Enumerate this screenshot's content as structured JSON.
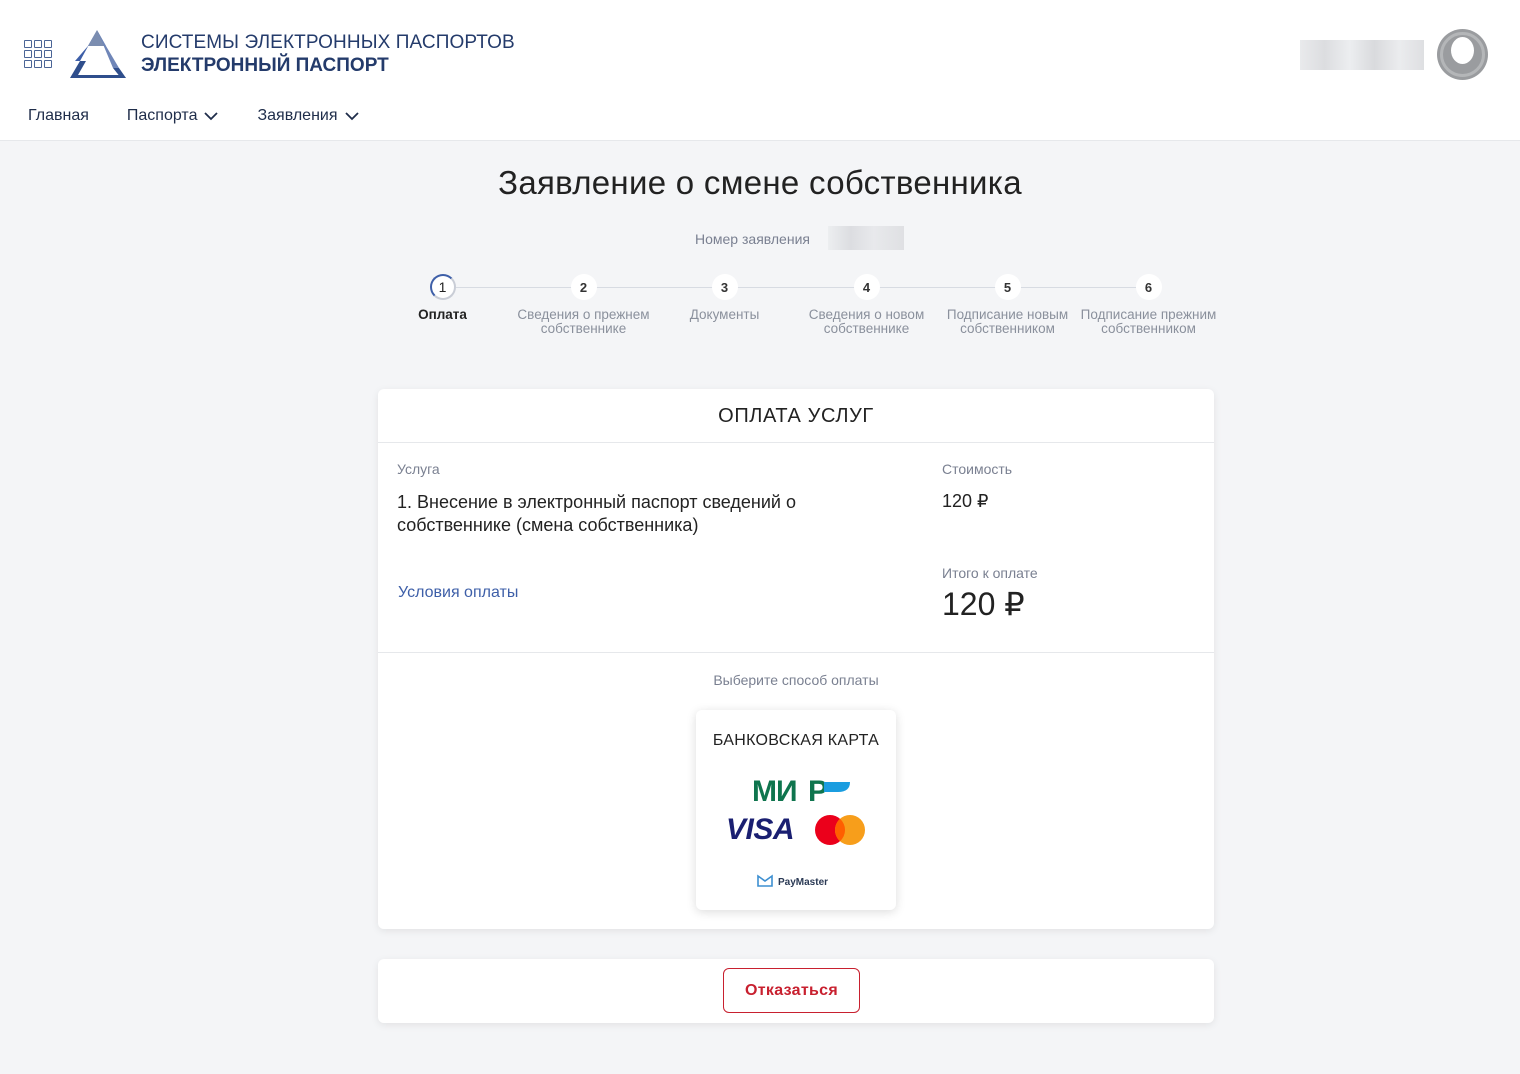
{
  "brand": {
    "line1": "СИСТЕМЫ ЭЛЕКТРОННЫХ ПАСПОРТОВ",
    "line2": "ЭЛЕКТРОННЫЙ ПАСПОРТ"
  },
  "nav": {
    "home": "Главная",
    "passports": "Паспорта",
    "applications": "Заявления"
  },
  "page": {
    "title": "Заявление о смене собственника",
    "number_label": "Номер заявления"
  },
  "steps": [
    {
      "num": "1",
      "label": "Оплата",
      "active": true
    },
    {
      "num": "2",
      "label": "Сведения о прежнем собственнике",
      "active": false
    },
    {
      "num": "3",
      "label": "Документы",
      "active": false
    },
    {
      "num": "4",
      "label": "Сведения о новом собственнике",
      "active": false
    },
    {
      "num": "5",
      "label": "Подписание новым собственником",
      "active": false
    },
    {
      "num": "6",
      "label": "Подписание прежним собственником",
      "active": false
    }
  ],
  "payment": {
    "header": "ОПЛАТА УСЛУГ",
    "service_label": "Услуга",
    "service_text": "1. Внесение в электронный паспорт сведений о собственнике (смена собственника)",
    "cost_label": "Стоимость",
    "cost_value": "120 ₽",
    "terms_link": "Условия оплаты",
    "total_label": "Итого к оплате",
    "total_value": "120 ₽",
    "choose_label": "Выберите способ оплаты",
    "method_title": "БАНКОВСКАЯ КАРТА",
    "logos": {
      "mir": "МИР",
      "visa": "VISA",
      "paymaster": "PayMaster"
    }
  },
  "actions": {
    "cancel": "Отказаться"
  },
  "colors": {
    "accent": "#3e5fa8",
    "brand": "#243b6b",
    "danger": "#c8202f",
    "mir_green": "#0f754e",
    "visa_blue": "#1a1f71"
  }
}
